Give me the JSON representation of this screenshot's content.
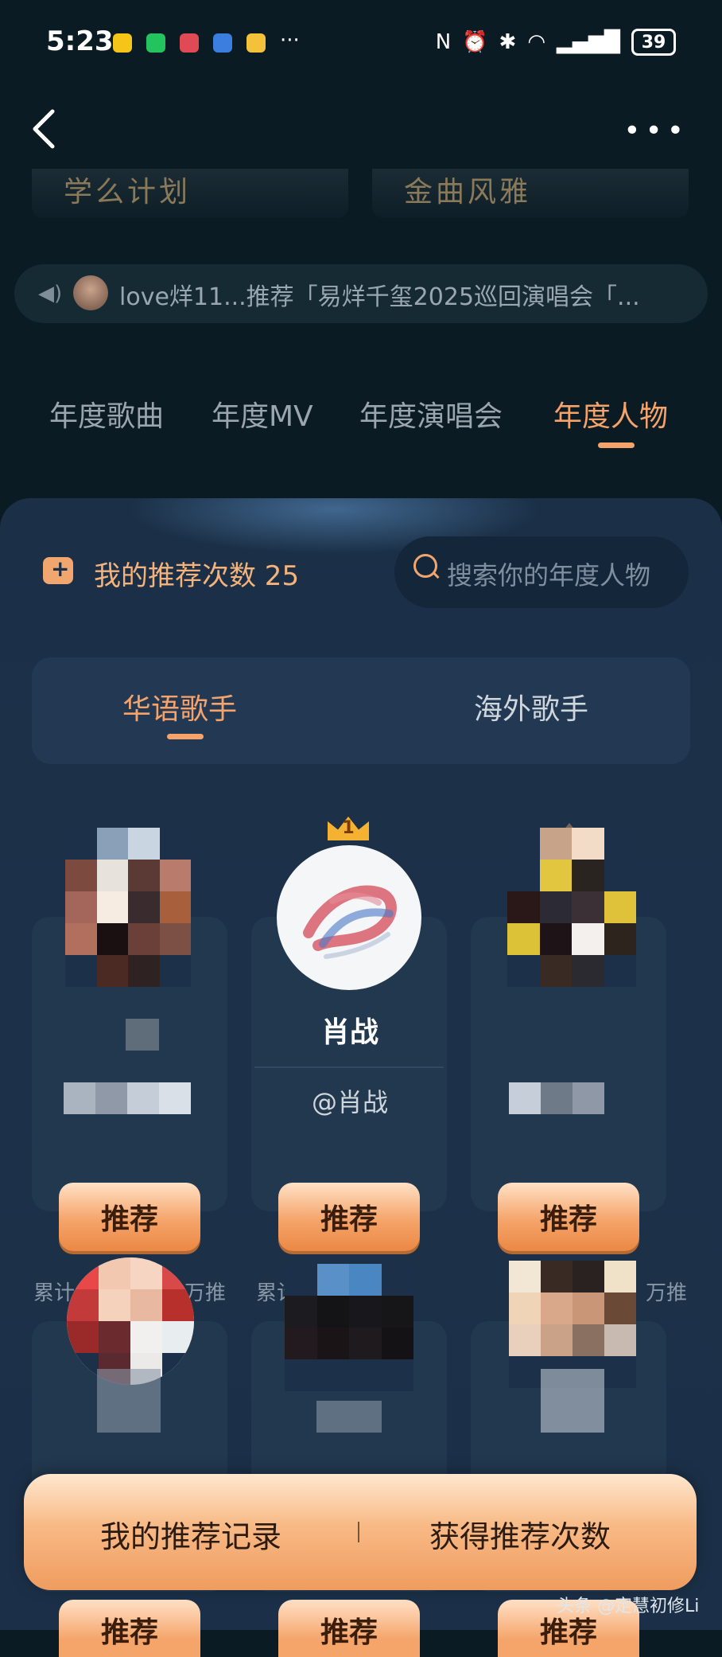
{
  "status_bar": {
    "time": "5:23",
    "more_apps": "···",
    "battery": "39"
  },
  "header": {
    "more_label": "•••"
  },
  "banners": [
    {
      "text": "学么计划"
    },
    {
      "text": "金曲风雅"
    }
  ],
  "ticker": {
    "text": "love烊11...推荐「易烊千玺2025巡回演唱会「..."
  },
  "tabs": [
    {
      "label": "年度歌曲",
      "active": false
    },
    {
      "label": "年度MV",
      "active": false
    },
    {
      "label": "年度演唱会",
      "active": false
    },
    {
      "label": "年度人物",
      "active": true
    }
  ],
  "recommend": {
    "label": "我的推荐次数 25"
  },
  "search": {
    "placeholder": "搜索你的年度人物"
  },
  "segments": [
    {
      "label": "华语歌手",
      "active": true
    },
    {
      "label": "海外歌手",
      "active": false
    }
  ],
  "cards": [
    {
      "rank": "?",
      "name": "",
      "handle": "",
      "button": "推荐",
      "cumulative": "累计",
      "cumulative_suffix": "万推"
    },
    {
      "rank": "1",
      "name": "肖战",
      "handle": "@肖战",
      "button": "推荐",
      "cumulative": "累计",
      "cumulative_suffix": ""
    },
    {
      "rank": "",
      "name": "",
      "handle": "",
      "button": "推荐",
      "cumulative": "",
      "cumulative_suffix": "万推"
    }
  ],
  "row2_buttons": [
    "推荐",
    "推荐",
    "推荐"
  ],
  "bottom_bar": {
    "left": "我的推荐记录",
    "right": "获得推荐次数"
  },
  "watermark": "头条 @定慧初修Li",
  "colors": {
    "accent": "#f5a36a",
    "background": "#0b1b24",
    "panel": "#1b3047"
  }
}
